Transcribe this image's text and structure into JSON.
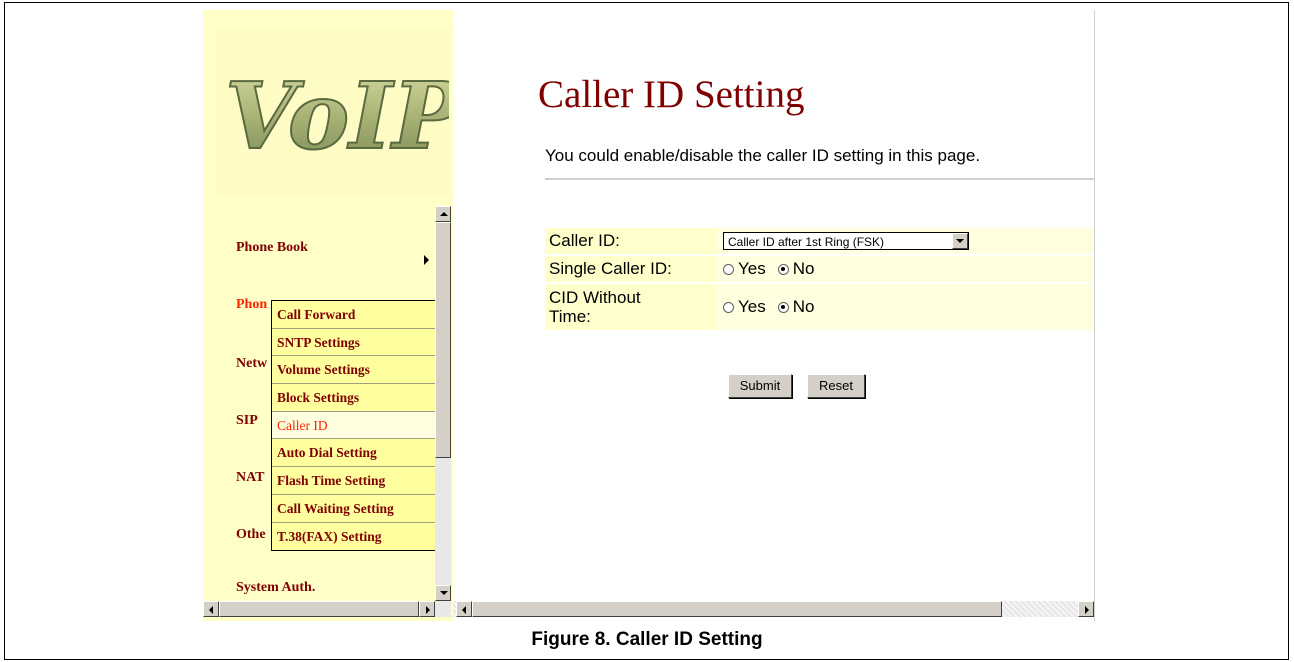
{
  "logo_text": "VoIP",
  "nav": {
    "items": [
      "Phone Book",
      "Phone Settings",
      "Network",
      "SIP",
      "NAT",
      "Others",
      "System Auth."
    ],
    "visible_labels": [
      "Phone Book",
      "Phon",
      "Netw",
      "SIP",
      "NAT",
      "Othe",
      "System Auth."
    ]
  },
  "submenu": {
    "items": [
      "Call Forward",
      "SNTP Settings",
      "Volume Settings",
      "Block Settings",
      "Caller ID",
      "Auto Dial Setting",
      "Flash Time Setting",
      "Call Waiting Setting",
      "T.38(FAX) Setting"
    ],
    "selected": "Caller ID"
  },
  "page": {
    "title": "Caller ID Setting",
    "description": "You could enable/disable the caller ID setting in this page."
  },
  "form": {
    "caller_id_label": "Caller ID:",
    "caller_id_value": "Caller ID after 1st Ring (FSK)",
    "single_label": "Single Caller ID:",
    "cid_label_line1": "CID Without",
    "cid_label_line2": "Time:",
    "yes": "Yes",
    "no": "No",
    "single_selected": "No",
    "cid_selected": "No"
  },
  "buttons": {
    "submit": "Submit",
    "reset": "Reset"
  },
  "caption": "Figure 8. Caller ID Setting",
  "colors": {
    "nav_text": "#800000",
    "nav_active": "#ff2400",
    "left_bg": "#ffffc8",
    "title": "#800000"
  }
}
